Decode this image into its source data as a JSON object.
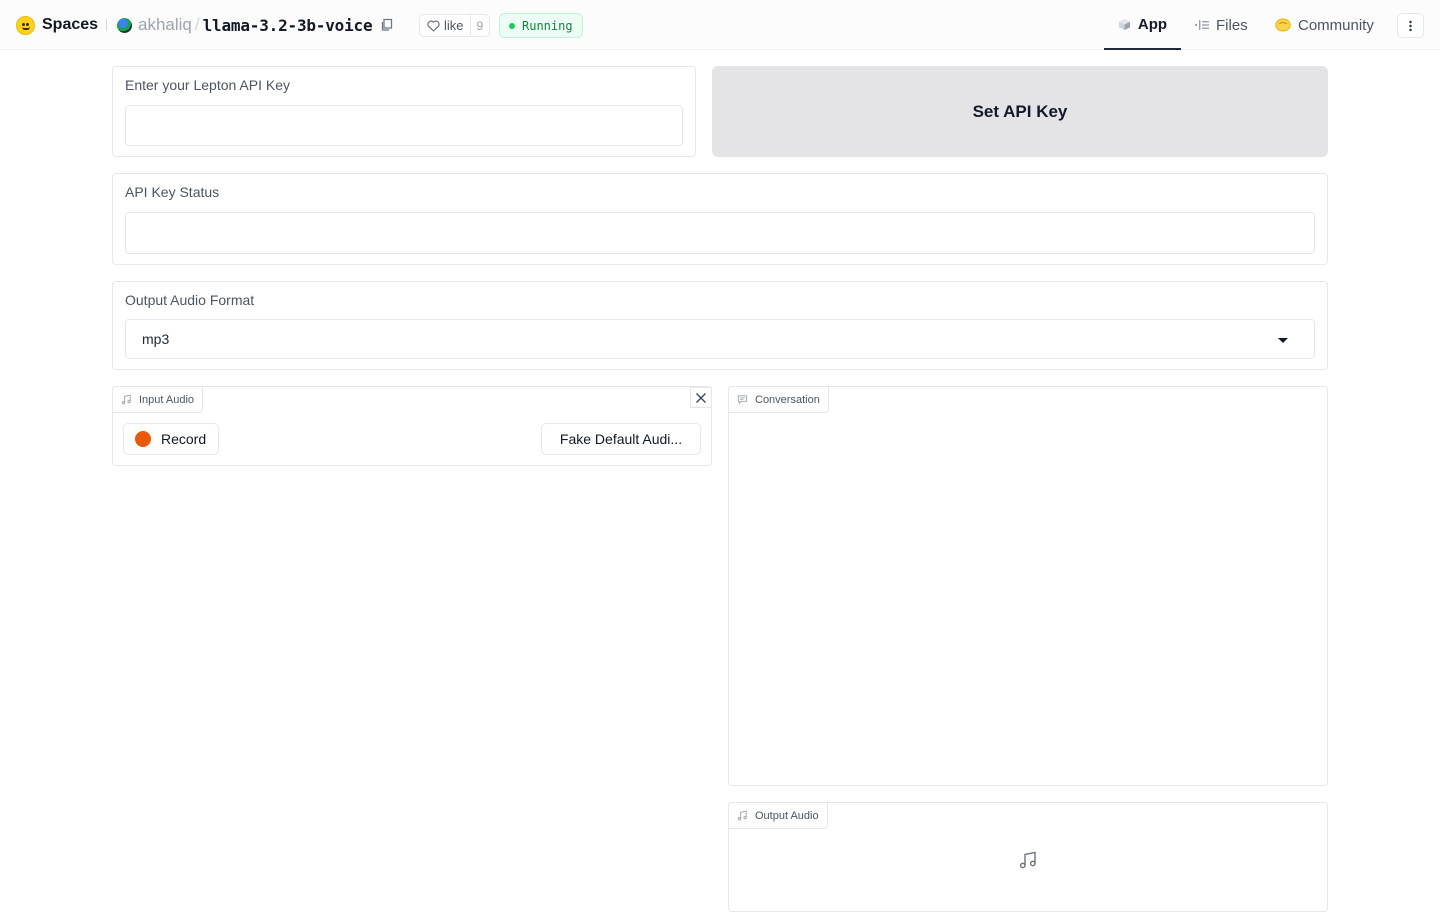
{
  "header": {
    "brand": "Spaces",
    "owner": "akhaliq",
    "separator": "/",
    "repo_name": "llama-3.2-3b-voice",
    "like_label": "like",
    "like_count": "9",
    "status": "Running",
    "status_color": "#22c55e",
    "nav": {
      "app": "App",
      "files": "Files",
      "community": "Community"
    }
  },
  "form": {
    "api_key_label": "Enter your Lepton API Key",
    "api_key_value": "",
    "set_key_button": "Set API Key",
    "status_label": "API Key Status",
    "status_value": "",
    "format_label": "Output Audio Format",
    "format_value": "mp3"
  },
  "input_audio": {
    "label": "Input Audio",
    "record_label": "Record",
    "fake_button": "Fake Default Audi..."
  },
  "conversation": {
    "label": "Conversation"
  },
  "output_audio": {
    "label": "Output Audio"
  },
  "colors": {
    "record": "#ea580c",
    "button_bg": "#e4e4e7",
    "accent": "#1f2937"
  }
}
